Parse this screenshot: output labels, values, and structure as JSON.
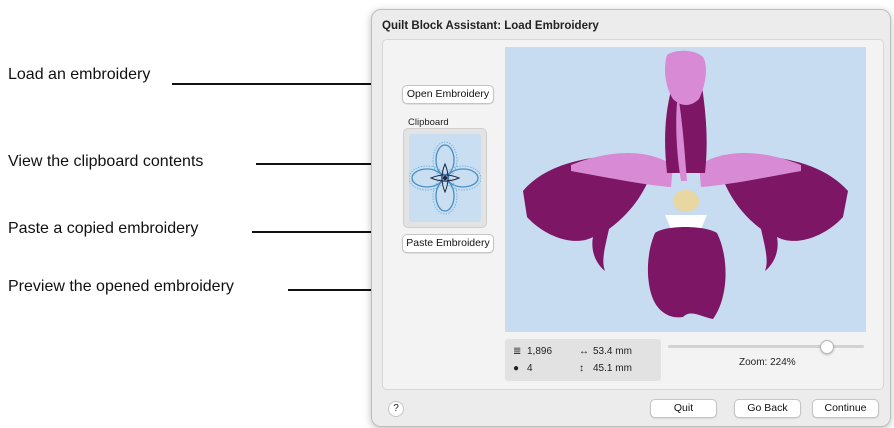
{
  "callouts": [
    {
      "label": "Load an embroidery"
    },
    {
      "label": "View the clipboard contents"
    },
    {
      "label": "Paste a copied embroidery"
    },
    {
      "label": "Preview the opened embroidery"
    }
  ],
  "dialog": {
    "title": "Quilt Block Assistant: Load Embroidery",
    "open_button": "Open Embroidery",
    "clipboard_label": "Clipboard",
    "paste_button": "Paste Embroidery",
    "stats": {
      "stitches": "1,896",
      "colors": "4",
      "width": "53.4 mm",
      "height": "45.1 mm"
    },
    "zoom": {
      "label": "Zoom: 224%",
      "value_percent": 224
    },
    "help_label": "?",
    "footer": {
      "quit": "Quit",
      "go_back": "Go Back",
      "continue": "Continue"
    }
  },
  "colors": {
    "preview_bg": "#c7dcf0",
    "petal_dark": "#7d1664",
    "petal_light": "#d98ad4",
    "center_yellow": "#e8d7a0"
  }
}
